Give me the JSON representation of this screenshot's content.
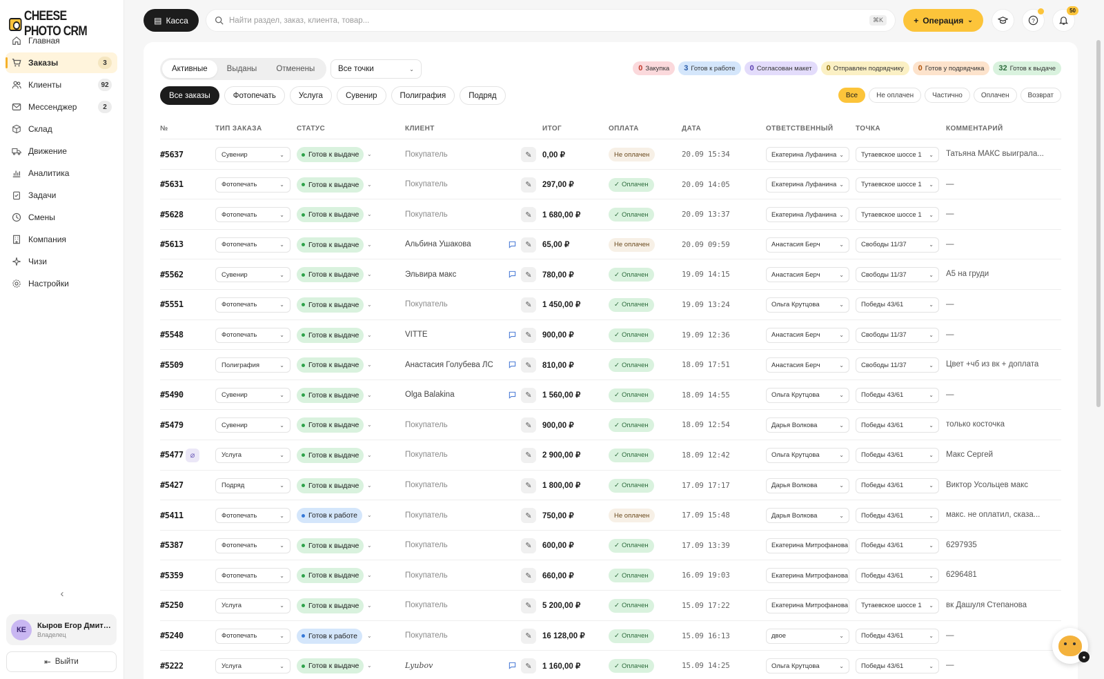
{
  "app": {
    "title": "CHEESE PHOTO CRM"
  },
  "sidebar": {
    "items": [
      {
        "label": "Главная",
        "icon": "home-icon",
        "count": ""
      },
      {
        "label": "Заказы",
        "icon": "cart-icon",
        "count": "3",
        "active": true
      },
      {
        "label": "Клиенты",
        "icon": "users-icon",
        "count": "92"
      },
      {
        "label": "Мессенджер",
        "icon": "mail-icon",
        "count": "2"
      },
      {
        "label": "Склад",
        "icon": "box-icon",
        "count": ""
      },
      {
        "label": "Движение",
        "icon": "truck-icon",
        "count": ""
      },
      {
        "label": "Аналитика",
        "icon": "chart-icon",
        "count": ""
      },
      {
        "label": "Задачи",
        "icon": "clipboard-icon",
        "count": ""
      },
      {
        "label": "Смены",
        "icon": "clock-icon",
        "count": ""
      },
      {
        "label": "Компания",
        "icon": "building-icon",
        "count": ""
      },
      {
        "label": "Чизи",
        "icon": "sparkle-icon",
        "count": ""
      },
      {
        "label": "Настройки",
        "icon": "gear-icon",
        "count": ""
      }
    ],
    "user": {
      "initials": "КЕ",
      "name": "Кыров Егор Дмитр...",
      "role": "Владелец"
    },
    "logout": "Выйти"
  },
  "topbar": {
    "kassa": "Касса",
    "search_placeholder": "Найти раздел, заказ, клиента, товар...",
    "search_shortcut": "⌘K",
    "operation": "Операция",
    "notifications": "50"
  },
  "tabs": [
    {
      "label": "Активные",
      "active": true
    },
    {
      "label": "Выданы"
    },
    {
      "label": "Отменены"
    }
  ],
  "point_filter": "Все точки",
  "stats": [
    {
      "count": "0",
      "label": "Закупка",
      "color": "#fbd9dc",
      "num": "#c0392b"
    },
    {
      "count": "3",
      "label": "Готов к работе",
      "color": "#d4e6fb",
      "num": "#2659a8"
    },
    {
      "count": "0",
      "label": "Согласован макет",
      "color": "#e3dcfb",
      "num": "#5b3fb0"
    },
    {
      "count": "0",
      "label": "Отправлен подрядчику",
      "color": "#fbf0c4",
      "num": "#8a6a00"
    },
    {
      "count": "0",
      "label": "Готов у подрядчика",
      "color": "#fde3cc",
      "num": "#b0560f"
    },
    {
      "count": "32",
      "label": "Готов к выдаче",
      "color": "#d9f2de",
      "num": "#2d6b3c"
    }
  ],
  "type_filters": [
    {
      "label": "Все заказы",
      "active": true
    },
    {
      "label": "Фотопечать"
    },
    {
      "label": "Услуга"
    },
    {
      "label": "Сувенир"
    },
    {
      "label": "Полиграфия"
    },
    {
      "label": "Подряд"
    }
  ],
  "pay_filters": [
    {
      "label": "Все",
      "active": true
    },
    {
      "label": "Не оплачен"
    },
    {
      "label": "Частично"
    },
    {
      "label": "Оплачен"
    },
    {
      "label": "Возврат"
    }
  ],
  "columns": [
    "№",
    "ТИП ЗАКАЗА",
    "СТАТУС",
    "КЛИЕНТ",
    "ИТОГ",
    "ОПЛАТА",
    "ДАТА",
    "ОТВЕТСТВЕННЫЙ",
    "ТОЧКА",
    "КОММЕНТАРИЙ"
  ],
  "status_colors": {
    "ready": "#d9f2de",
    "ready_dot": "#2fa14a",
    "work": "#d4e6fb",
    "work_dot": "#3578d8"
  },
  "orders": [
    {
      "num": "#5637",
      "type": "Сувенир",
      "status": "Готов к выдаче",
      "st": "ready",
      "client": "Покупатель",
      "muted": true,
      "msg": false,
      "total": "0,00 ₽",
      "pay": "Не оплачен",
      "paid": false,
      "date": "20.09 15:34",
      "resp": "Екатерина Луфанина",
      "point": "Тутаевское шоссе 1",
      "comment": "Татьяна МАКС выиграла..."
    },
    {
      "num": "#5631",
      "type": "Фотопечать",
      "status": "Готов к выдаче",
      "st": "ready",
      "client": "Покупатель",
      "muted": true,
      "msg": false,
      "total": "297,00 ₽",
      "pay": "Оплачен",
      "paid": true,
      "date": "20.09 14:05",
      "resp": "Екатерина Луфанина",
      "point": "Тутаевское шоссе 1",
      "comment": "—"
    },
    {
      "num": "#5628",
      "type": "Фотопечать",
      "status": "Готов к выдаче",
      "st": "ready",
      "client": "Покупатель",
      "muted": true,
      "msg": false,
      "total": "1 680,00 ₽",
      "pay": "Оплачен",
      "paid": true,
      "date": "20.09 13:37",
      "resp": "Екатерина Луфанина",
      "point": "Тутаевское шоссе 1",
      "comment": "—"
    },
    {
      "num": "#5613",
      "type": "Фотопечать",
      "status": "Готов к выдаче",
      "st": "ready",
      "client": "Альбина Ушакова",
      "muted": false,
      "msg": true,
      "total": "65,00 ₽",
      "pay": "Не оплачен",
      "paid": false,
      "date": "20.09 09:59",
      "resp": "Анастасия Берч",
      "point": "Свободы 11/37",
      "comment": "—"
    },
    {
      "num": "#5562",
      "type": "Сувенир",
      "status": "Готов к выдаче",
      "st": "ready",
      "client": "Эльвира макс",
      "muted": false,
      "msg": true,
      "total": "780,00 ₽",
      "pay": "Оплачен",
      "paid": true,
      "date": "19.09 14:15",
      "resp": "Анастасия Берч",
      "point": "Свободы 11/37",
      "comment": "А5 на груди"
    },
    {
      "num": "#5551",
      "type": "Фотопечать",
      "status": "Готов к выдаче",
      "st": "ready",
      "client": "Покупатель",
      "muted": true,
      "msg": false,
      "total": "1 450,00 ₽",
      "pay": "Оплачен",
      "paid": true,
      "date": "19.09 13:24",
      "resp": "Ольга Крутцова",
      "point": "Победы 43/61",
      "comment": "—"
    },
    {
      "num": "#5548",
      "type": "Фотопечать",
      "status": "Готов к выдаче",
      "st": "ready",
      "client": "VITTE",
      "muted": false,
      "msg": true,
      "total": "900,00 ₽",
      "pay": "Оплачен",
      "paid": true,
      "date": "19.09 12:36",
      "resp": "Анастасия Берч",
      "point": "Свободы 11/37",
      "comment": "—"
    },
    {
      "num": "#5509",
      "type": "Полиграфия",
      "status": "Готов к выдаче",
      "st": "ready",
      "client": "Анастасия Голубева ЛС",
      "muted": false,
      "msg": true,
      "total": "810,00 ₽",
      "pay": "Оплачен",
      "paid": true,
      "date": "18.09 17:51",
      "resp": "Анастасия Берч",
      "point": "Свободы 11/37",
      "comment": "Цвет +чб из вк + доплата"
    },
    {
      "num": "#5490",
      "type": "Сувенир",
      "status": "Готов к выдаче",
      "st": "ready",
      "client": "Olga Balakina",
      "muted": false,
      "msg": true,
      "total": "1 560,00 ₽",
      "pay": "Оплачен",
      "paid": true,
      "date": "18.09 14:55",
      "resp": "Ольга Крутцова",
      "point": "Победы 43/61",
      "comment": "—"
    },
    {
      "num": "#5479",
      "type": "Сувенир",
      "status": "Готов к выдаче",
      "st": "ready",
      "client": "Покупатель",
      "muted": true,
      "msg": false,
      "total": "900,00 ₽",
      "pay": "Оплачен",
      "paid": true,
      "date": "18.09 12:54",
      "resp": "Дарья Волкова",
      "point": "Победы 43/61",
      "comment": "только косточка"
    },
    {
      "num": "#5477",
      "clip": true,
      "type": "Услуга",
      "status": "Готов к выдаче",
      "st": "ready",
      "client": "Покупатель",
      "muted": true,
      "msg": false,
      "total": "2 900,00 ₽",
      "pay": "Оплачен",
      "paid": true,
      "date": "18.09 12:42",
      "resp": "Ольга Крутцова",
      "point": "Победы 43/61",
      "comment": "Макс Сергей"
    },
    {
      "num": "#5427",
      "type": "Подряд",
      "status": "Готов к выдаче",
      "st": "ready",
      "client": "Покупатель",
      "muted": true,
      "msg": false,
      "total": "1 800,00 ₽",
      "pay": "Оплачен",
      "paid": true,
      "date": "17.09 17:17",
      "resp": "Дарья Волкова",
      "point": "Победы 43/61",
      "comment": "Виктор Усольцев макс"
    },
    {
      "num": "#5411",
      "type": "Фотопечать",
      "status": "Готов к работе",
      "st": "work",
      "client": "Покупатель",
      "muted": true,
      "msg": false,
      "total": "750,00 ₽",
      "pay": "Не оплачен",
      "paid": false,
      "date": "17.09 15:48",
      "resp": "Дарья Волкова",
      "point": "Победы 43/61",
      "comment": "макс. не оплатил, сказа..."
    },
    {
      "num": "#5387",
      "type": "Фотопечать",
      "status": "Готов к выдаче",
      "st": "ready",
      "client": "Покупатель",
      "muted": true,
      "msg": false,
      "total": "600,00 ₽",
      "pay": "Оплачен",
      "paid": true,
      "date": "17.09 13:39",
      "resp": "Екатерина Митрофанова",
      "point": "Победы 43/61",
      "comment": "6297935"
    },
    {
      "num": "#5359",
      "type": "Фотопечать",
      "status": "Готов к выдаче",
      "st": "ready",
      "client": "Покупатель",
      "muted": true,
      "msg": false,
      "total": "660,00 ₽",
      "pay": "Оплачен",
      "paid": true,
      "date": "16.09 19:03",
      "resp": "Екатерина Митрофанова",
      "point": "Победы 43/61",
      "comment": "6296481"
    },
    {
      "num": "#5250",
      "type": "Услуга",
      "status": "Готов к выдаче",
      "st": "ready",
      "client": "Покупатель",
      "muted": true,
      "msg": false,
      "total": "5 200,00 ₽",
      "pay": "Оплачен",
      "paid": true,
      "date": "15.09 17:22",
      "resp": "Екатерина Митрофанова",
      "point": "Тутаевское шоссе 1",
      "comment": "вк Дашуля Степанова"
    },
    {
      "num": "#5240",
      "type": "Фотопечать",
      "status": "Готов к работе",
      "st": "work",
      "client": "Покупатель",
      "muted": true,
      "msg": false,
      "total": "16 128,00 ₽",
      "pay": "Оплачен",
      "paid": true,
      "date": "15.09 16:13",
      "resp": "двое",
      "point": "Победы 43/61",
      "comment": "—"
    },
    {
      "num": "#5222",
      "type": "Услуга",
      "status": "Готов к выдаче",
      "st": "ready",
      "client": "Lyubov",
      "muted": false,
      "msg": true,
      "total": "1 160,00 ₽",
      "pay": "Оплачен",
      "paid": true,
      "date": "15.09 14:25",
      "resp": "Ольга Крутцова",
      "point": "Победы 43/61",
      "comment": "—"
    }
  ]
}
